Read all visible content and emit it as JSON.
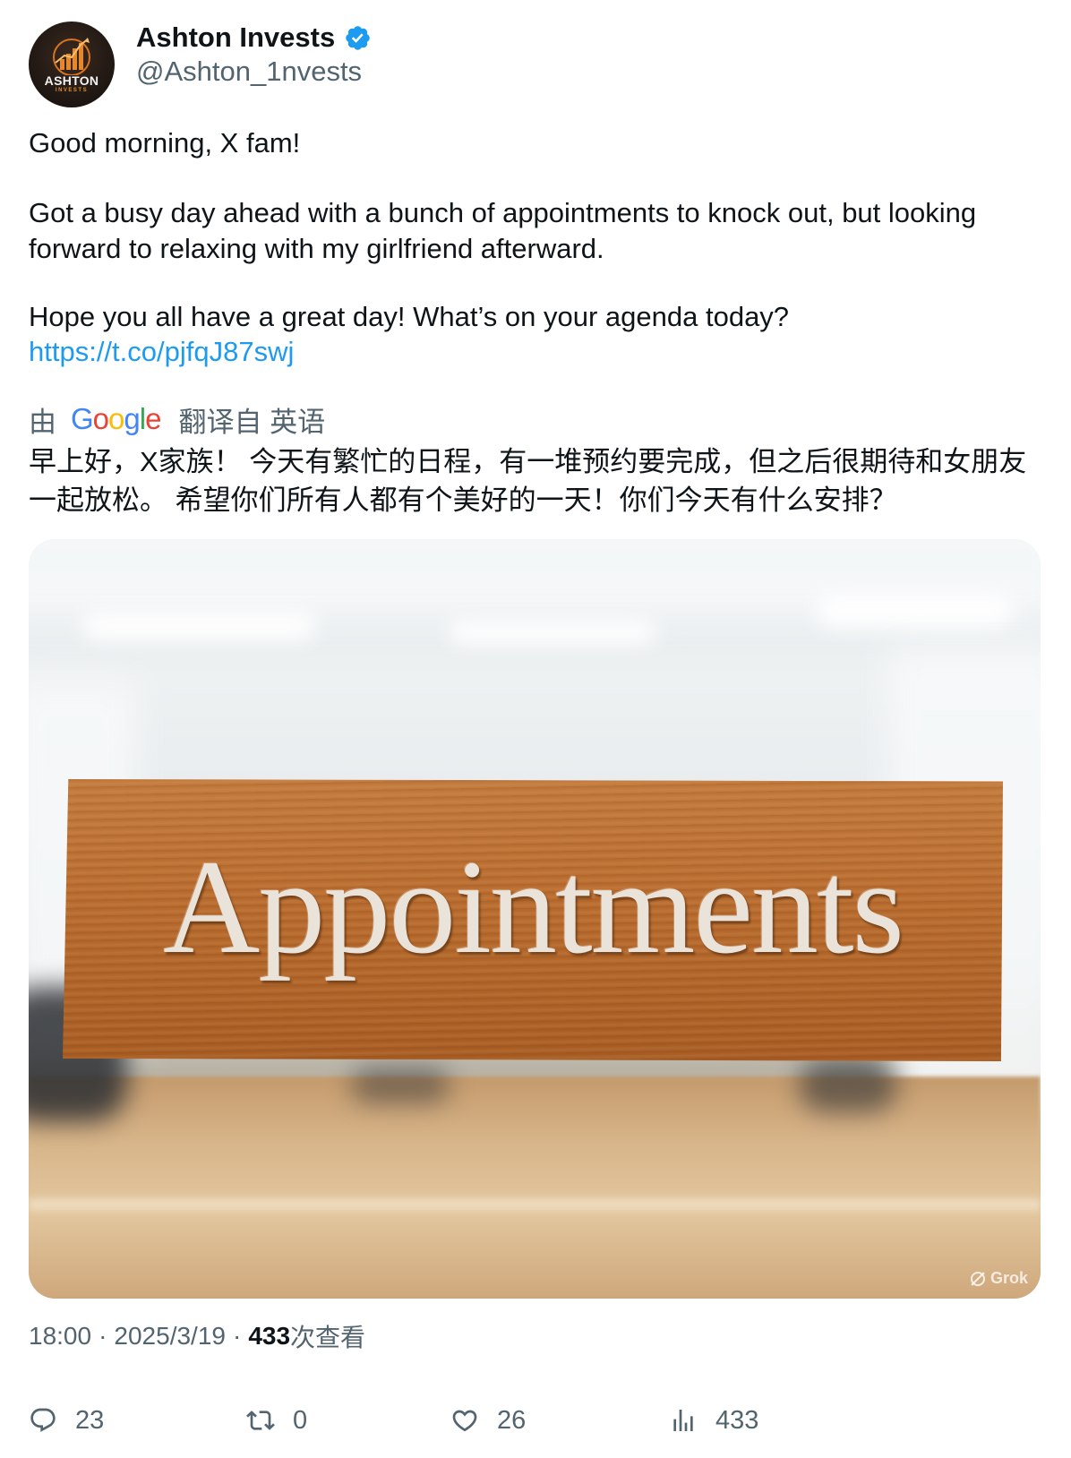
{
  "author": {
    "display_name": "Ashton Invests",
    "handle": "@Ashton_1nvests",
    "verified_icon": "verified-badge-icon",
    "avatar_text": "ASHTON",
    "avatar_subtext": "INVESTS"
  },
  "post": {
    "greeting": "Good morning, X fam!",
    "paragraph_1": "Got a busy day ahead with a bunch of appointments to knock out, but looking forward to relaxing with my girlfriend afterward.",
    "paragraph_2": "Hope you all have a great day! What’s on your agenda today?",
    "link": "https://t.co/pjfqJ87swj"
  },
  "translation": {
    "prefix": "由",
    "provider": "Google",
    "provider_letters": [
      "G",
      "o",
      "o",
      "g",
      "l",
      "e"
    ],
    "from_label": "翻译自 英语",
    "text": "早上好，X家族！ 今天有繁忙的日程，有一堆预约要完成，但之后很期待和女朋友一起放松。 希望你们所有人都有个美好的一天！你们今天有什么安排？"
  },
  "media": {
    "sign_text": "Appointments",
    "watermark": "Grok"
  },
  "meta": {
    "time": "18:00",
    "separator": "·",
    "date": "2025/3/19",
    "views_count": "433",
    "views_label": "次查看"
  },
  "actions": {
    "replies": {
      "icon": "reply-icon",
      "count": "23"
    },
    "reposts": {
      "icon": "repost-icon",
      "count": "0"
    },
    "likes": {
      "icon": "heart-icon",
      "count": "26"
    },
    "views": {
      "icon": "analytics-icon",
      "count": "433"
    }
  },
  "colors": {
    "text_primary": "#0f1419",
    "text_secondary": "#536471",
    "link": "#1d9bf0",
    "verified": "#1d9bf0"
  }
}
